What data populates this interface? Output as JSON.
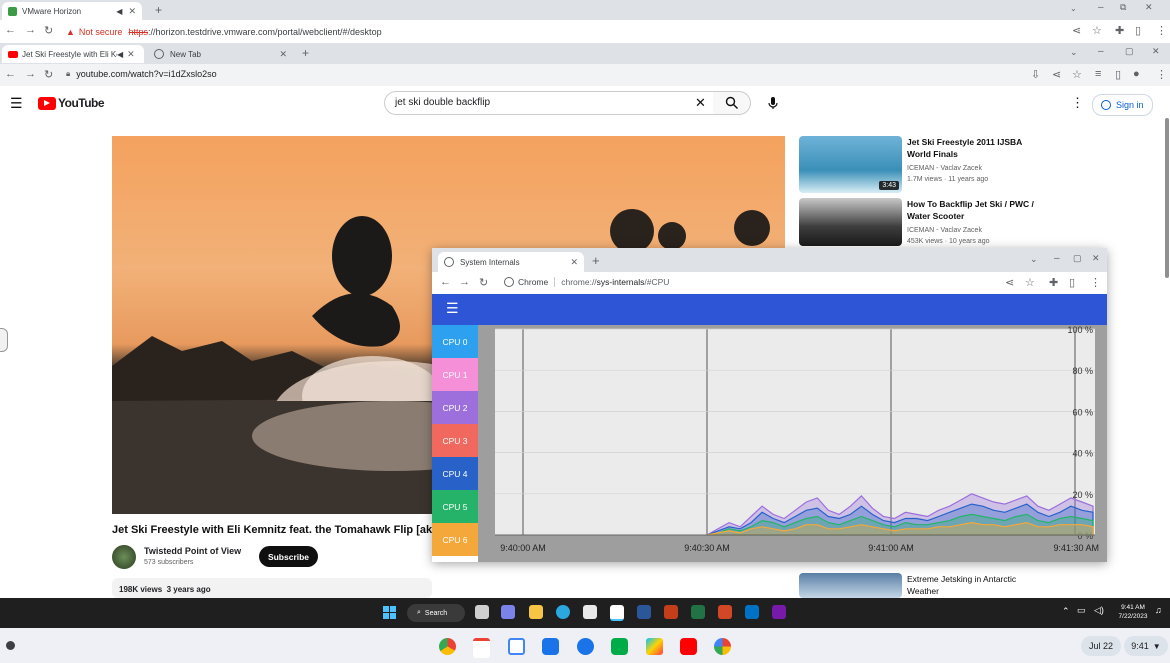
{
  "outer_browser": {
    "tabs": [
      {
        "title": "VMware Horizon"
      }
    ],
    "not_secure": "Not secure",
    "url_https": "https",
    "url_rest": "://horizon.testdrive.vmware.com/portal/webclient/#/desktop"
  },
  "inner_browser": {
    "tabs": [
      {
        "title": "Jet Ski Freestyle with Eli Kemn"
      },
      {
        "title": "New Tab"
      }
    ],
    "url": "youtube.com/watch?v=i1dZxslo2so"
  },
  "youtube": {
    "logo_text": "YouTube",
    "search_value": "jet ski double backflip",
    "sign_in": "Sign in",
    "video_title": "Jet Ski Freestyle with Eli Kemnitz feat. the Tomahawk Flip [aka",
    "channel": {
      "name": "Twistedd Point of View",
      "subscribers": "573 subscribers",
      "subscribe": "Subscribe"
    },
    "stats": "198K views  3 years ago",
    "recommendations": [
      {
        "title": "Jet Ski Freestyle 2011 IJSBA World Finals",
        "channel": "ICEMAN - Vaclav Zacek",
        "meta": "1.7M views · 11 years ago",
        "duration": "3:43"
      },
      {
        "title": "How To Backflip Jet Ski / PWC / Water Scooter",
        "channel": "ICEMAN - Vaclav Zacek",
        "meta": "453K views · 10 years ago",
        "duration": ""
      },
      {
        "title": "Extreme Jetsking in Antarctic Weather",
        "channel": "",
        "meta": "",
        "duration": ""
      }
    ]
  },
  "sys_internals": {
    "tab_title": "System Internals",
    "omnibox_chip": "Chrome",
    "url_prefix": "chrome://",
    "url_host": "sys-internals",
    "url_path": "/#CPU",
    "cpus": [
      {
        "label": "CPU 0",
        "color": "#2ea0f0"
      },
      {
        "label": "CPU 1",
        "color": "#f48fd8"
      },
      {
        "label": "CPU 2",
        "color": "#9c6fdc"
      },
      {
        "label": "CPU 3",
        "color": "#f0685e"
      },
      {
        "label": "CPU 4",
        "color": "#2862c8"
      },
      {
        "label": "CPU 5",
        "color": "#25b36a"
      },
      {
        "label": "CPU 6",
        "color": "#f5a83a"
      }
    ]
  },
  "chart_data": {
    "type": "area",
    "x_ticks": [
      "9:40:00 AM",
      "9:40:30 AM",
      "9:41:00 AM",
      "9:41:30 AM"
    ],
    "y_ticks": [
      "100 %",
      "80 %",
      "60 %",
      "40 %",
      "20 %",
      "0 %"
    ],
    "ylim": [
      0,
      100
    ],
    "grid": true,
    "x": [
      0,
      1,
      2,
      3,
      4,
      5,
      6,
      7,
      8,
      9,
      10,
      11,
      12,
      13,
      14,
      15,
      16,
      17,
      18,
      19,
      20,
      21,
      22,
      23,
      24,
      25,
      26,
      27,
      28,
      29,
      30,
      31,
      32,
      33,
      34,
      35
    ],
    "series": [
      {
        "color": "#9c6fdc",
        "values": [
          0,
          3,
          6,
          4,
          9,
          14,
          10,
          8,
          12,
          16,
          18,
          12,
          10,
          14,
          19,
          13,
          9,
          8,
          11,
          10,
          9,
          12,
          14,
          17,
          20,
          18,
          16,
          15,
          17,
          19,
          14,
          12,
          15,
          18,
          16,
          14
        ]
      },
      {
        "color": "#2862c8",
        "values": [
          0,
          2,
          4,
          3,
          6,
          11,
          8,
          6,
          9,
          12,
          13,
          9,
          8,
          10,
          14,
          10,
          7,
          6,
          8,
          8,
          7,
          9,
          11,
          13,
          15,
          14,
          12,
          11,
          13,
          15,
          11,
          9,
          11,
          14,
          12,
          11
        ]
      },
      {
        "color": "#25b36a",
        "values": [
          0,
          1,
          3,
          2,
          4,
          7,
          6,
          4,
          6,
          8,
          9,
          6,
          5,
          7,
          9,
          7,
          5,
          4,
          6,
          5,
          5,
          6,
          7,
          9,
          10,
          9,
          8,
          7,
          9,
          10,
          7,
          6,
          8,
          9,
          8,
          7
        ]
      },
      {
        "color": "#f5a83a",
        "values": [
          0,
          1,
          2,
          1,
          3,
          4,
          3,
          2,
          3,
          5,
          5,
          3,
          3,
          4,
          5,
          4,
          3,
          2,
          3,
          3,
          3,
          4,
          4,
          5,
          6,
          5,
          5,
          4,
          5,
          6,
          4,
          4,
          5,
          5,
          5,
          4
        ]
      }
    ]
  },
  "windows_taskbar": {
    "search_label": "Search",
    "time": "9:41 AM",
    "date": "7/22/2023"
  },
  "chromeos_shelf": {
    "date": "Jul 22",
    "time": "9:41"
  }
}
